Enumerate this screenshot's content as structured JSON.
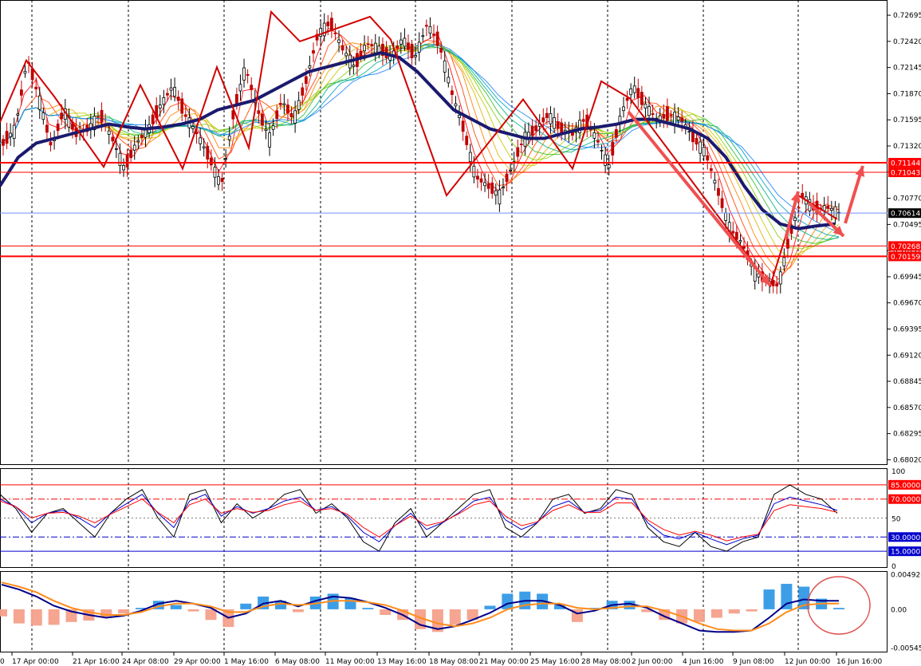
{
  "chart_data": [
    {
      "type": "candlestick",
      "price_ticks": [
        "0.72695",
        "0.72420",
        "0.72145",
        "0.71870",
        "0.71595",
        "0.71320",
        "0.71045",
        "0.70770",
        "0.70495",
        "0.70220",
        "0.69945",
        "0.69670",
        "0.69395",
        "0.69120",
        "0.68845",
        "0.68570",
        "0.68295",
        "0.68020"
      ],
      "ylim": [
        0.6799,
        0.7283
      ],
      "x_labels": [
        "17 Apr 00:00",
        "21 Apr 16:00",
        "24 Apr 08:00",
        "29 Apr 00:00",
        "1 May 16:00",
        "6 May 08:00",
        "11 May 00:00",
        "13 May 16:00",
        "18 May 08:00",
        "21 May 00:00",
        "25 May 16:00",
        "28 May 08:00",
        "2 Jun 00:00",
        "4 Jun 16:00",
        "9 Jun 08:00",
        "12 Jun 00:00",
        "16 Jun 16:00"
      ],
      "x_label_left_partial": "0",
      "close_path": [
        0.7135,
        0.715,
        0.7224,
        0.718,
        0.713,
        0.717,
        0.7145,
        0.715,
        0.7165,
        0.714,
        0.7108,
        0.7135,
        0.715,
        0.7175,
        0.7195,
        0.7165,
        0.7145,
        0.712,
        0.709,
        0.7165,
        0.7215,
        0.717,
        0.714,
        0.718,
        0.716,
        0.72,
        0.725,
        0.7262,
        0.7235,
        0.7215,
        0.724,
        0.7235,
        0.7225,
        0.7245,
        0.7225,
        0.726,
        0.724,
        0.719,
        0.715,
        0.71,
        0.709,
        0.708,
        0.711,
        0.714,
        0.715,
        0.7165,
        0.715,
        0.7145,
        0.716,
        0.714,
        0.711,
        0.7165,
        0.7195,
        0.7175,
        0.716,
        0.7165,
        0.716,
        0.714,
        0.7125,
        0.7085,
        0.7045,
        0.703,
        0.7,
        0.699,
        0.6985,
        0.704,
        0.708,
        0.7065,
        0.7068,
        0.7062
      ],
      "key_ma_path": [
        0.709,
        0.712,
        0.7135,
        0.714,
        0.7145,
        0.715,
        0.7155,
        0.7152,
        0.715,
        0.7152,
        0.7155,
        0.716,
        0.717,
        0.7175,
        0.718,
        0.719,
        0.72,
        0.721,
        0.7215,
        0.722,
        0.7225,
        0.723,
        0.7225,
        0.721,
        0.719,
        0.717,
        0.716,
        0.715,
        0.7145,
        0.714,
        0.714,
        0.7145,
        0.715,
        0.7152,
        0.7155,
        0.716,
        0.716,
        0.7155,
        0.715,
        0.714,
        0.712,
        0.709,
        0.7065,
        0.705,
        0.7045,
        0.7048,
        0.705
      ],
      "horizontal_levels": [
        {
          "label": "0.71144",
          "value": 0.71144,
          "color": "#ff0000",
          "thick": true
        },
        {
          "label": "0.71043",
          "value": 0.71043,
          "color": "#ff0000",
          "thick": false
        },
        {
          "label": "0.70614",
          "value": 0.70614,
          "color": "#000000",
          "thick": false,
          "current_price": true
        },
        {
          "label": "0.70268",
          "value": 0.70268,
          "color": "#ff0000",
          "thick": false
        },
        {
          "label": "0.70159",
          "value": 0.70159,
          "color": "#ff0000",
          "thick": true
        }
      ],
      "zigzag": [
        0.7157,
        0.7222,
        0.7184,
        0.711,
        0.7196,
        0.7108,
        0.7215,
        0.713,
        0.7273,
        0.7242,
        0.7268,
        0.7244,
        0.708,
        0.7181,
        0.7108,
        0.72,
        0.7182,
        0.6985,
        0.708,
        0.7055
      ]
    },
    {
      "type": "line",
      "name": "oscillator",
      "ylim": [
        0,
        100
      ],
      "tick_labels": [
        "100",
        "50",
        "0"
      ],
      "levels": [
        {
          "label": "85.0000",
          "value": 85,
          "color": "#ff0000",
          "style": "solid"
        },
        {
          "label": "70.0000",
          "value": 70,
          "color": "#ff0000",
          "style": "dash-dot"
        },
        {
          "label": "30.0000",
          "value": 30,
          "color": "#0000cc",
          "style": "dash-dot"
        },
        {
          "label": "15.0000",
          "value": 15,
          "color": "#0000cc",
          "style": "solid"
        }
      ],
      "series": [
        {
          "color": "#000000",
          "values": [
            75,
            60,
            35,
            55,
            60,
            45,
            30,
            55,
            70,
            80,
            50,
            30,
            75,
            80,
            45,
            65,
            50,
            60,
            75,
            80,
            55,
            65,
            50,
            25,
            15,
            45,
            60,
            30,
            45,
            60,
            75,
            80,
            40,
            30,
            45,
            70,
            75,
            55,
            60,
            80,
            75,
            40,
            25,
            20,
            35,
            20,
            15,
            25,
            30,
            75,
            85,
            75,
            70,
            55
          ]
        },
        {
          "color": "#0000cc",
          "values": [
            70,
            62,
            45,
            55,
            58,
            50,
            40,
            55,
            65,
            75,
            55,
            40,
            68,
            75,
            52,
            62,
            55,
            60,
            68,
            72,
            58,
            62,
            52,
            35,
            25,
            42,
            55,
            38,
            45,
            55,
            68,
            72,
            48,
            38,
            45,
            62,
            68,
            56,
            58,
            72,
            70,
            45,
            32,
            28,
            35,
            28,
            22,
            28,
            32,
            65,
            72,
            68,
            64,
            58
          ]
        },
        {
          "color": "#ff0000",
          "values": [
            68,
            62,
            50,
            55,
            56,
            52,
            45,
            54,
            62,
            70,
            56,
            45,
            64,
            70,
            55,
            60,
            56,
            58,
            64,
            68,
            58,
            60,
            54,
            40,
            30,
            42,
            52,
            42,
            46,
            54,
            64,
            68,
            52,
            42,
            46,
            58,
            64,
            56,
            56,
            66,
            66,
            48,
            38,
            32,
            36,
            32,
            26,
            30,
            33,
            58,
            64,
            62,
            60,
            56
          ]
        }
      ]
    },
    {
      "type": "histogram+line",
      "name": "macd",
      "ylim": [
        -0.0061,
        0.0054
      ],
      "tick_labels": [
        "0.004928",
        "0.00",
        "-0.00545"
      ],
      "histogram": [
        -0.001,
        -0.002,
        -0.0023,
        -0.0022,
        -0.0018,
        -0.0016,
        -0.0012,
        -0.0006,
        0.0002,
        0.0012,
        0.0006,
        -0.0003,
        -0.0015,
        -0.0025,
        0.0008,
        0.0018,
        0.0012,
        -0.0004,
        0.0018,
        0.0022,
        0.0016,
        0.0002,
        -0.0008,
        -0.0015,
        -0.0028,
        -0.0032,
        -0.0022,
        -0.0015,
        0.0005,
        0.0022,
        0.0025,
        0.0022,
        0.0006,
        -0.0018,
        0.0002,
        0.0012,
        0.0012,
        -0.0004,
        -0.0015,
        -0.002,
        -0.0018,
        -0.0012,
        -0.0006,
        -0.0003,
        0.0028,
        0.0036,
        0.0032,
        0.0015,
        0.0002
      ],
      "series": [
        {
          "color": "#000088",
          "values": [
            0.0035,
            0.0028,
            0.0018,
            0.0005,
            -0.0003,
            -0.0008,
            -0.0012,
            -0.0009,
            -0.0002,
            0.0008,
            0.0012,
            0.0008,
            0.0002,
            -0.0012,
            -0.0006,
            0.0008,
            0.0012,
            0.0004,
            0.0012,
            0.0018,
            0.0016,
            0.001,
            0.0002,
            -0.0008,
            -0.0022,
            -0.0028,
            -0.0024,
            -0.0015,
            -0.0005,
            0.0008,
            0.0012,
            0.0012,
            0.0006,
            -0.0006,
            -0.0002,
            0.0006,
            0.0008,
            0.0002,
            -0.001,
            -0.002,
            -0.003,
            -0.0032,
            -0.0032,
            -0.003,
            -0.0012,
            0.0008,
            0.0014,
            0.0012,
            0.0012
          ]
        },
        {
          "color": "#ff8c1a",
          "values": [
            0.0038,
            0.0032,
            0.0024,
            0.0012,
            0.0002,
            -0.0004,
            -0.0008,
            -0.0008,
            -0.0004,
            0.0004,
            0.0008,
            0.0008,
            0.0004,
            -0.0004,
            -0.0004,
            0.0004,
            0.0008,
            0.0006,
            0.0008,
            0.0012,
            0.0012,
            0.001,
            0.0006,
            -0.0002,
            -0.0012,
            -0.002,
            -0.0024,
            -0.002,
            -0.0012,
            0.0,
            0.0006,
            0.0008,
            0.0008,
            0.0002,
            0.0,
            0.0002,
            0.0004,
            0.0004,
            -0.0002,
            -0.001,
            -0.002,
            -0.0028,
            -0.003,
            -0.003,
            -0.002,
            -0.0004,
            0.0006,
            0.0008,
            0.0008
          ]
        }
      ]
    }
  ]
}
